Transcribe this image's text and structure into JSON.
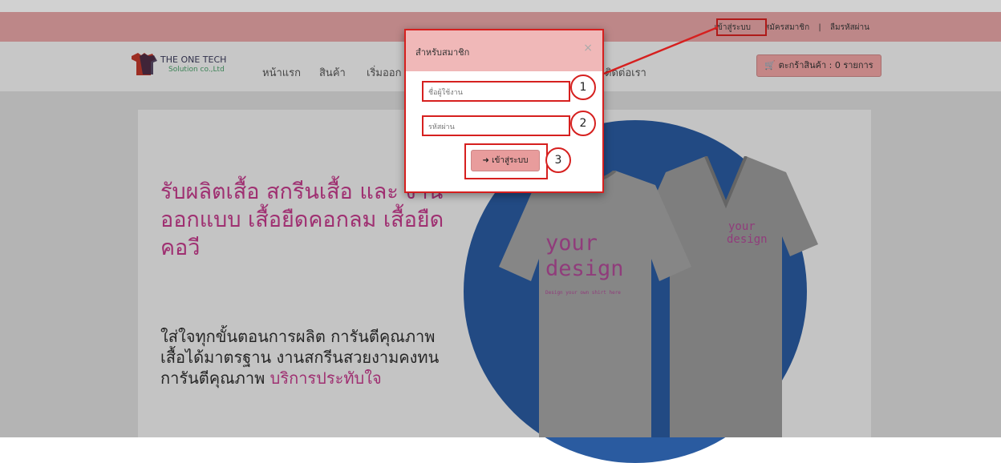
{
  "topbar": {
    "login": "เข้าสู่ระบบ",
    "register": "สมัครสมาชิก",
    "separator": "|",
    "forgot": "ลืมรหัสผ่าน"
  },
  "logo": {
    "line1": "THE ONE TECH",
    "line2": "Solution co.,Ltd"
  },
  "nav": {
    "home": "หน้าแรก",
    "products": "สินค้า",
    "design": "เริ่มออก",
    "contact": "ติดต่อเรา"
  },
  "cart": {
    "label": "ตะกร้าสินค้า : 0 รายการ"
  },
  "hero": {
    "title": "รับผลิตเสื้อ สกรีนเสื้อ และ งานออกแบบ เสื้อยืดคอกลม เสื้อยืดคอวี",
    "sub_main": "ใส่ใจทุกขั้นตอนการผลิต การันตีคุณภาพ เสื้อได้มาตรฐาน งานสกรีนสวยงามคงทน การันตีคุณภาพ ",
    "sub_highlight": "บริการประทับใจ"
  },
  "shirt": {
    "front_line1": "your",
    "front_line2": "design",
    "front_small": "Design your own shirt here",
    "back_line1": "your",
    "back_line2": "design"
  },
  "modal": {
    "title": "สำหรับสมาชิก",
    "close": "×",
    "username_placeholder": "ชื่อผู้ใช้งาน",
    "password_placeholder": "รหัสผ่าน",
    "submit": "เข้าสู่ระบบ"
  },
  "annotations": {
    "one": "1",
    "two": "2",
    "three": "3"
  },
  "colors": {
    "accent": "#d6201f",
    "topbar": "#e7a5a6",
    "brand_pink": "#c23a8a",
    "circle": "#2a5ba0"
  }
}
